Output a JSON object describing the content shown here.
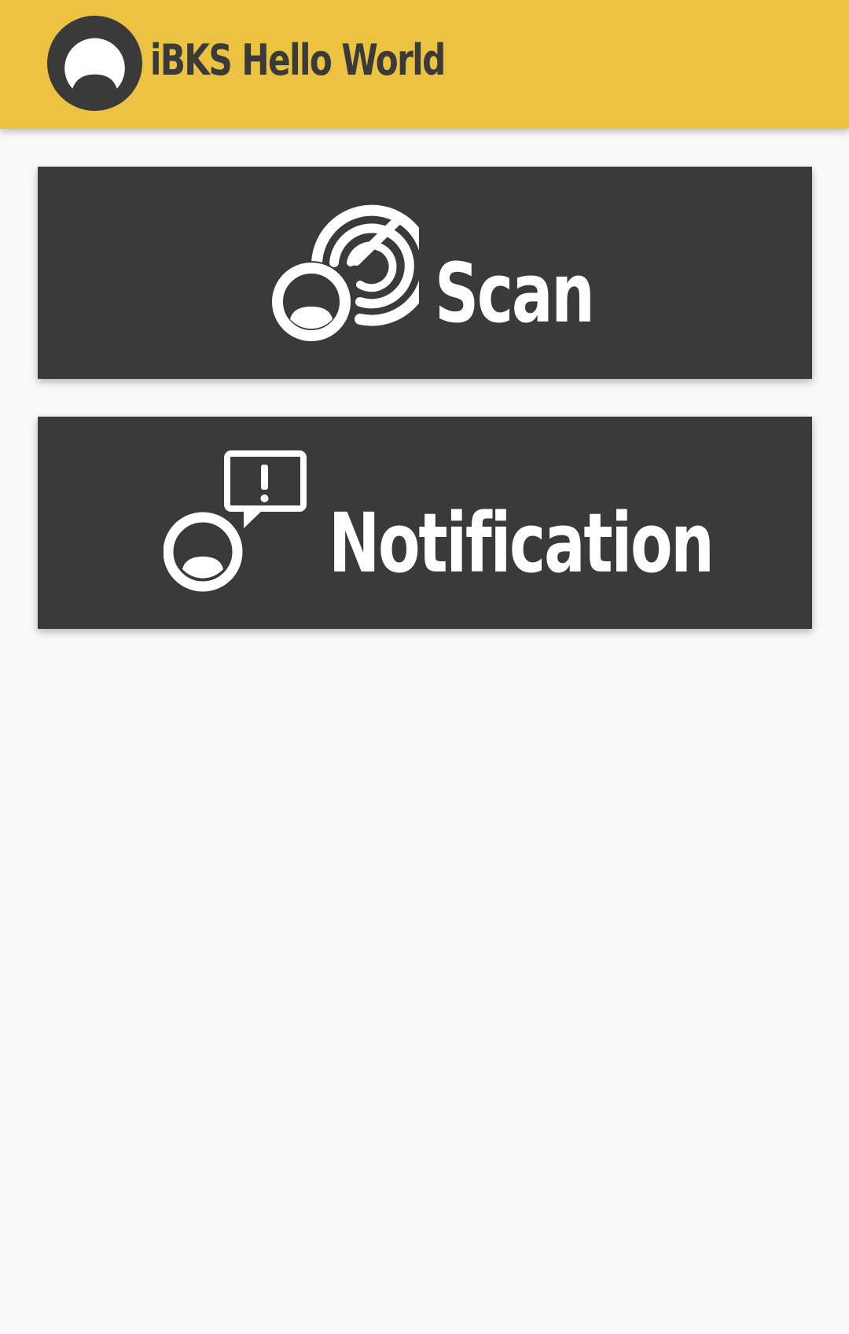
{
  "app": {
    "title": "iBKS Hello World",
    "logo_icon": "ibks-beacon-logo-icon",
    "colors": {
      "appbar": "#ebc340",
      "card": "#3a3a3a",
      "background": "#f9f9f9",
      "text_dark": "#3a3a3a",
      "text_light": "#ffffff"
    }
  },
  "menu": {
    "scan": {
      "label": "Scan",
      "icon": "beacon-radar-icon"
    },
    "notification": {
      "label": "Notification",
      "icon": "beacon-alert-icon"
    }
  }
}
